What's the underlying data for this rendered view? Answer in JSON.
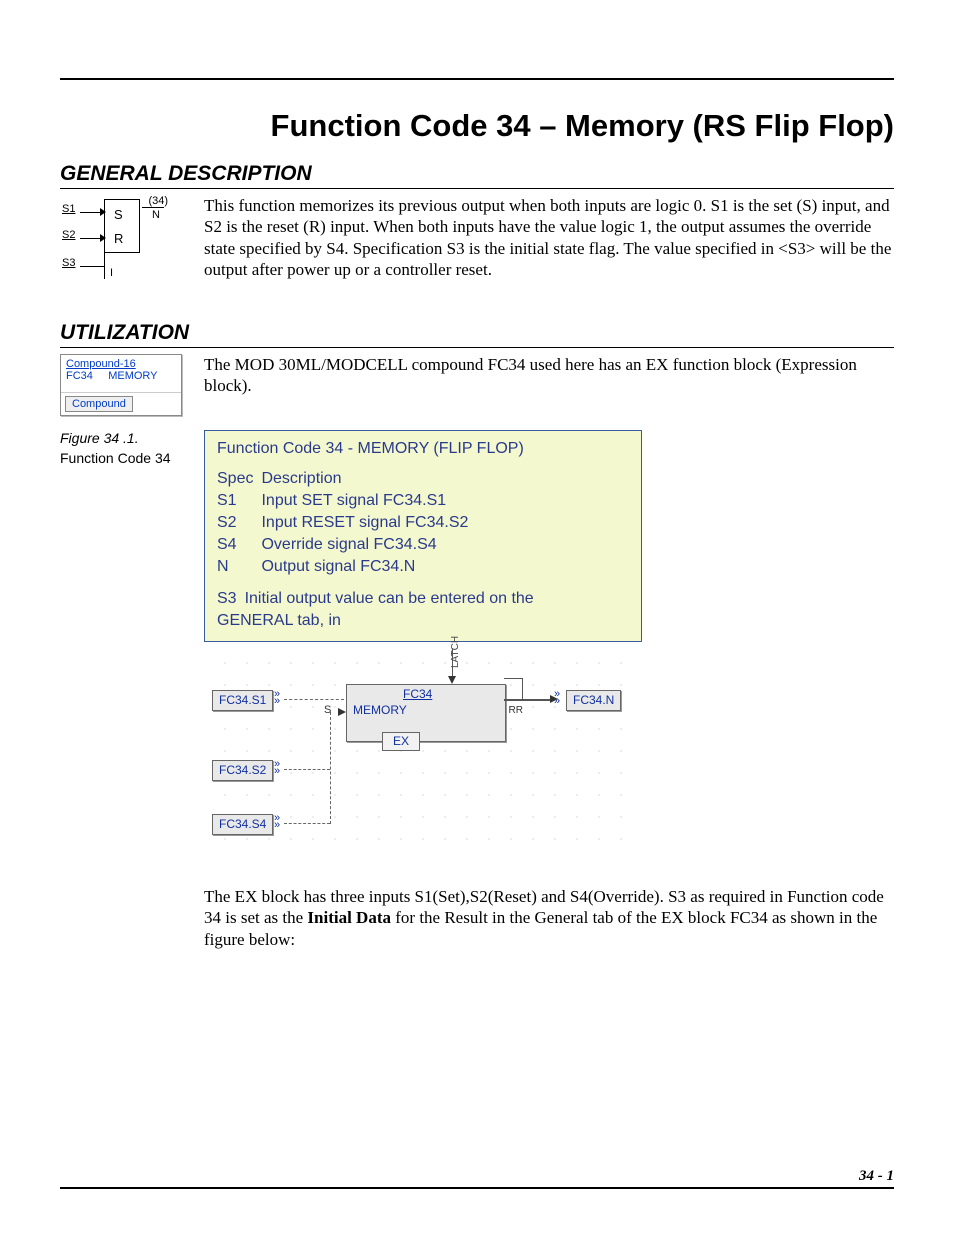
{
  "title": "Function Code 34 – Memory (RS Flip Flop)",
  "page_number": "34 - 1",
  "sections": {
    "gen": {
      "heading": "GENERAL DESCRIPTION",
      "body": "This function memorizes its previous output when both inputs are logic 0. S1 is the set (S) input, and S2 is the reset (R) input. When both inputs have the value logic 1, the output assumes the override state specified by S4. Specification S3 is the initial state flag. The value specified in <S3> will be the output after power up or a controller reset."
    },
    "util": {
      "heading": "UTILIZATION",
      "intro": "The MOD 30ML/MODCELL compound FC34 used here has an EX function block (Expression block).",
      "outro_pre": "The EX block has three inputs S1(Set),S2(Reset) and S4(Override). S3 as required in Function code 34 is set as the ",
      "outro_bold": "Initial Data",
      "outro_post": " for the Result in the General tab of the EX block FC34 as shown in the figure below:"
    }
  },
  "sr_icon": {
    "inputs": [
      "S1",
      "S2",
      "S3"
    ],
    "rows": [
      "S",
      "R"
    ],
    "code": "(34)",
    "out": "N",
    "i": "I"
  },
  "compound_thumb": {
    "link": "Compound-16",
    "left": "FC34",
    "right": "MEMORY",
    "button": "Compound"
  },
  "figure_caption": {
    "l1": "Figure 34 .1.",
    "l2": "Function Code 34"
  },
  "spec_panel": {
    "title": "Function Code 34 - MEMORY (FLIP FLOP)",
    "header": {
      "c1": "Spec",
      "c2": "Description"
    },
    "rows": [
      {
        "c1": "S1",
        "c2": "Input SET signal FC34.S1"
      },
      {
        "c1": "S2",
        "c2": "Input RESET signal FC34.S2"
      },
      {
        "c1": "S4",
        "c2": "Override signal FC34.S4"
      },
      {
        "c1": "N",
        "c2": "Output signal FC34.N"
      }
    ],
    "s3_label": "S3",
    "s3_text": "Initial output value can be entered on the",
    "s3_cont": "GENERAL tab, in"
  },
  "diagram": {
    "latch": "LATCH",
    "nodes": {
      "s1": "FC34.S1",
      "s2": "FC34.S2",
      "s4": "FC34.S4",
      "n": "FC34.N"
    },
    "big": {
      "top": "FC34",
      "sub": "MEMORY",
      "rr": "RR"
    },
    "ex": "EX",
    "s_label": "S"
  }
}
